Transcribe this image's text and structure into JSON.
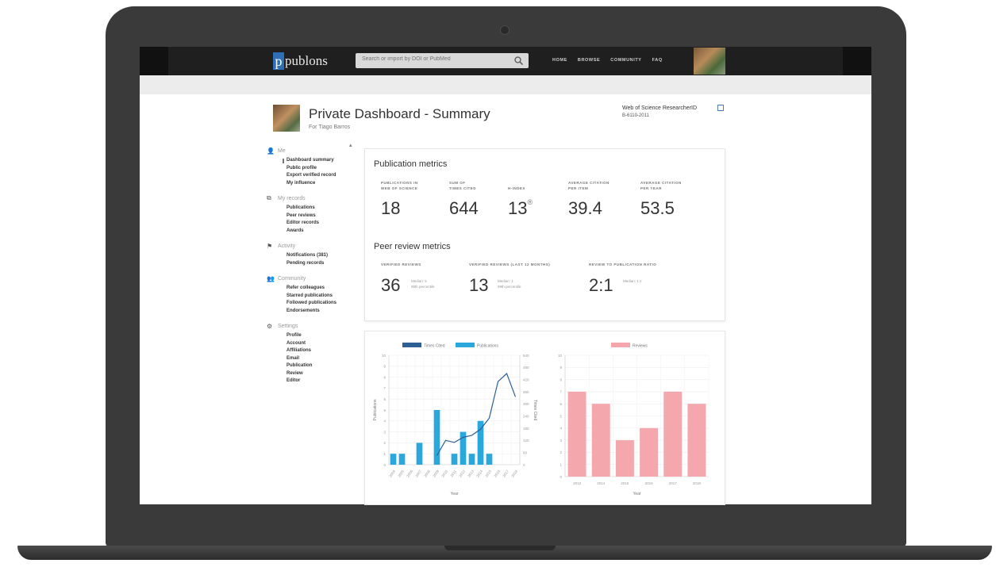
{
  "topbar": {
    "logo": "publons",
    "logo_mark": "p",
    "search_placeholder": "Search or import by DOI or PubMed",
    "nav": [
      "HOME",
      "BROWSE",
      "COMMUNITY",
      "FAQ"
    ]
  },
  "header": {
    "title": "Private Dashboard - Summary",
    "subtitle": "For Tiago Barros",
    "researcher_id_label": "Web of Science ResearcherID",
    "researcher_id_value": "B-6110-2011"
  },
  "sidebar": {
    "groups": [
      {
        "icon": "user-icon",
        "label": "Me",
        "items": [
          "Dashboard summary",
          "Public profile",
          "Export verified record",
          "My influence"
        ]
      },
      {
        "icon": "records-icon",
        "label": "My records",
        "items": [
          "Publications",
          "Peer reviews",
          "Editor records",
          "Awards"
        ]
      },
      {
        "icon": "flag-icon",
        "label": "Activity",
        "items": [
          "Notifications (381)",
          "Pending records"
        ]
      },
      {
        "icon": "community-icon",
        "label": "Community",
        "items": [
          "Refer colleagues",
          "Starred publications",
          "Followed publications",
          "Endorsements"
        ]
      },
      {
        "icon": "gear-icon",
        "label": "Settings",
        "items": [
          "Profile",
          "Account",
          "Affiliations",
          "Email",
          "Publication",
          "Review",
          "Editor"
        ]
      }
    ]
  },
  "publication_metrics": {
    "title": "Publication metrics",
    "metrics": [
      {
        "label_lines": [
          "Publications in",
          "Web of Science"
        ],
        "value": "18"
      },
      {
        "label_lines": [
          "Sum of",
          "times cited"
        ],
        "value": "644"
      },
      {
        "label_lines": [
          "H-index"
        ],
        "value": "13",
        "suffix": "®"
      },
      {
        "label_lines": [
          "Average citation",
          "per item"
        ],
        "value": "39.4"
      },
      {
        "label_lines": [
          "Average citation",
          "per year"
        ],
        "value": "53.5"
      }
    ]
  },
  "peer_review_metrics": {
    "title": "Peer review metrics",
    "metrics": [
      {
        "label": "Verified reviews",
        "value": "36",
        "note_lines": [
          "Median: 5",
          "99th percentile"
        ]
      },
      {
        "label": "Verified reviews (last 12 months)",
        "value": "13",
        "note_lines": [
          "Median: 1",
          "99th percentile"
        ]
      },
      {
        "label": "Review to publication ratio",
        "value": "2:1",
        "note_lines": [
          "Median: 1:2"
        ]
      }
    ]
  },
  "chart_data": [
    {
      "type": "bar",
      "secondary_type": "line",
      "legend": [
        "Times Cited",
        "Publications"
      ],
      "legend_position": "top",
      "xlabel": "Year",
      "ylabel": "Publications",
      "y2label": "Times Cited",
      "categories": [
        "2004",
        "2005",
        "2006",
        "2007",
        "2008",
        "2009",
        "2010",
        "2011",
        "2012",
        "2013",
        "2014",
        "2015",
        "2016",
        "2017",
        "2018"
      ],
      "series": [
        {
          "name": "Publications",
          "values": [
            1,
            1,
            0,
            2,
            0,
            5,
            0,
            1,
            3,
            1,
            4,
            1,
            0,
            0,
            0
          ]
        },
        {
          "name": "Times Cited",
          "values": [
            0,
            0,
            0,
            0,
            0,
            45,
            120,
            110,
            135,
            145,
            175,
            230,
            410,
            450,
            335
          ]
        }
      ],
      "ylim": [
        0,
        10
      ],
      "y2lim": [
        0,
        540
      ],
      "yticks": [
        0,
        1,
        2,
        3,
        4,
        5,
        6,
        7,
        8,
        9,
        10
      ],
      "y2ticks": [
        0,
        60,
        120,
        180,
        240,
        300,
        360,
        420,
        480,
        540
      ],
      "grid": true,
      "colors": {
        "Publications": "#2aa8db",
        "Times Cited": "#2d5f94"
      }
    },
    {
      "type": "bar",
      "legend": [
        "Reviews"
      ],
      "legend_position": "top",
      "xlabel": "Year",
      "categories": [
        "2013",
        "2014",
        "2015",
        "2016",
        "2017",
        "2018"
      ],
      "series": [
        {
          "name": "Reviews",
          "values": [
            7,
            6,
            3,
            4,
            7,
            6
          ]
        }
      ],
      "ylim": [
        0,
        10
      ],
      "yticks": [
        0,
        1,
        2,
        3,
        4,
        5,
        6,
        7,
        8,
        9,
        10
      ],
      "grid": true,
      "colors": {
        "Reviews": "#f4a7ad"
      }
    }
  ]
}
